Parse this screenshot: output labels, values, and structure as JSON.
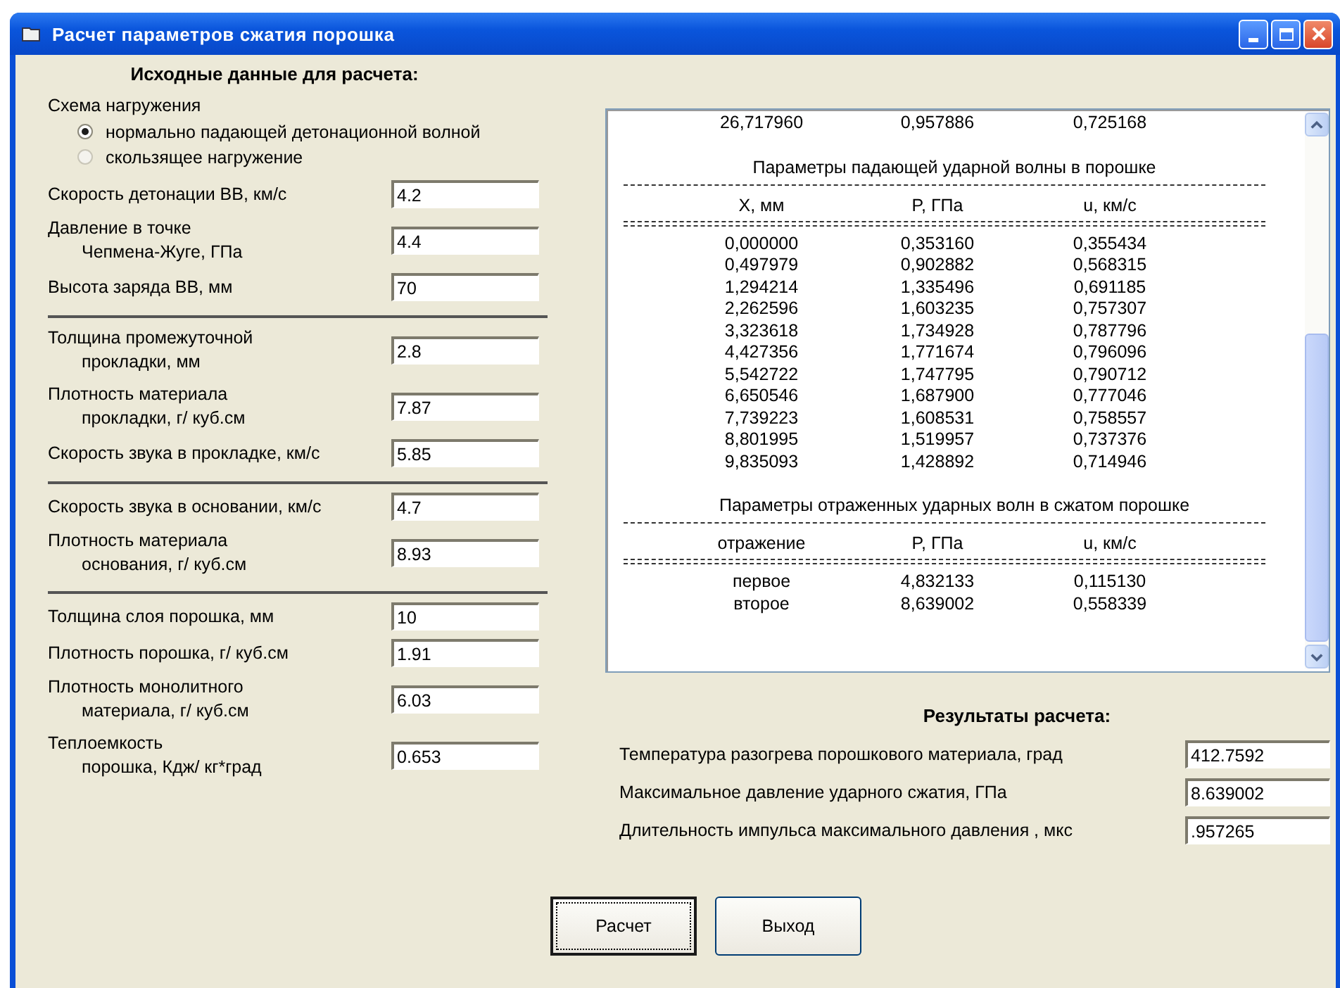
{
  "window": {
    "title": "Расчет параметров сжатия порошка"
  },
  "input_heading": "Исходные данные для расчета:",
  "loading_scheme": {
    "label": "Схема нагружения",
    "options": [
      {
        "label": "нормально падающей детонационной волной",
        "selected": true
      },
      {
        "label": "скользящее нагружение",
        "selected": false
      }
    ]
  },
  "groups": [
    {
      "fields": [
        {
          "label": [
            "Скорость детонации ВВ, км/с"
          ],
          "value": "4.2"
        },
        {
          "label": [
            "Давление в точке",
            "Чепмена-Жуге, ГПа"
          ],
          "value": "4.4"
        },
        {
          "label": [
            "Высота заряда ВВ, мм"
          ],
          "value": "70"
        }
      ]
    },
    {
      "fields": [
        {
          "label": [
            "Толщина промежуточной",
            "прокладки, мм"
          ],
          "value": "2.8"
        },
        {
          "label": [
            "Плотность материала",
            "прокладки, г/ куб.см"
          ],
          "value": "7.87"
        },
        {
          "label": [
            "Скорость звука в прокладке, км/с"
          ],
          "value": "5.85"
        }
      ]
    },
    {
      "fields": [
        {
          "label": [
            "Скорость звука в основании, км/с"
          ],
          "value": "4.7"
        },
        {
          "label": [
            "Плотность материала",
            "основания, г/ куб.см"
          ],
          "value": "8.93"
        }
      ]
    },
    {
      "fields": [
        {
          "label": [
            "Толщина слоя порошка, мм"
          ],
          "value": "10"
        },
        {
          "label": [
            "Плотность порошка, г/ куб.см"
          ],
          "value": "1.91"
        },
        {
          "label": [
            "Плотность монолитного",
            "материала, г/ куб.см"
          ],
          "value": "6.03"
        },
        {
          "label": [
            "Теплоемкость",
            "порошка, Кдж/ кг*град"
          ],
          "value": "0.653"
        }
      ]
    }
  ],
  "output_lines": [
    {
      "kind": "row",
      "cells": [
        "26,717960",
        "0,957886",
        "0,725168"
      ]
    },
    {
      "kind": "heading",
      "text": "Параметры падающей ударной волны в порошке"
    },
    {
      "kind": "dashed"
    },
    {
      "kind": "header",
      "cells": [
        "X, мм",
        "P, ГПа",
        "u, км/с"
      ]
    },
    {
      "kind": "double"
    },
    {
      "kind": "row",
      "cells": [
        "0,000000",
        "0,353160",
        "0,355434"
      ]
    },
    {
      "kind": "row",
      "cells": [
        "0,497979",
        "0,902882",
        "0,568315"
      ]
    },
    {
      "kind": "row",
      "cells": [
        "1,294214",
        "1,335496",
        "0,691185"
      ]
    },
    {
      "kind": "row",
      "cells": [
        "2,262596",
        "1,603235",
        "0,757307"
      ]
    },
    {
      "kind": "row",
      "cells": [
        "3,323618",
        "1,734928",
        "0,787796"
      ]
    },
    {
      "kind": "row",
      "cells": [
        "4,427356",
        "1,771674",
        "0,796096"
      ]
    },
    {
      "kind": "row",
      "cells": [
        "5,542722",
        "1,747795",
        "0,790712"
      ]
    },
    {
      "kind": "row",
      "cells": [
        "6,650546",
        "1,687900",
        "0,777046"
      ]
    },
    {
      "kind": "row",
      "cells": [
        "7,739223",
        "1,608531",
        "0,758557"
      ]
    },
    {
      "kind": "row",
      "cells": [
        "8,801995",
        "1,519957",
        "0,737376"
      ]
    },
    {
      "kind": "row",
      "cells": [
        "9,835093",
        "1,428892",
        "0,714946"
      ]
    },
    {
      "kind": "heading",
      "text": "Параметры отраженных ударных волн в сжатом порошке"
    },
    {
      "kind": "dashed"
    },
    {
      "kind": "header",
      "cells": [
        "отражение",
        "P, ГПа",
        "u, км/с"
      ]
    },
    {
      "kind": "double"
    },
    {
      "kind": "row",
      "cells": [
        "первое",
        "4,832133",
        "0,115130"
      ]
    },
    {
      "kind": "row",
      "cells": [
        "второе",
        "8,639002",
        "0,558339"
      ]
    }
  ],
  "results_heading": "Результаты расчета:",
  "results": [
    {
      "label": "Температура разогрева порошкового материала, град",
      "value": "412.7592"
    },
    {
      "label": "Максимальное давление ударного сжатия, ГПа",
      "value": "8.639002"
    },
    {
      "label": "Длительность импульса максимального давления , мкс",
      "value": ".957265"
    }
  ],
  "buttons": [
    {
      "label": "Расчет",
      "focused": true
    },
    {
      "label": "Выход",
      "focused": false
    }
  ]
}
